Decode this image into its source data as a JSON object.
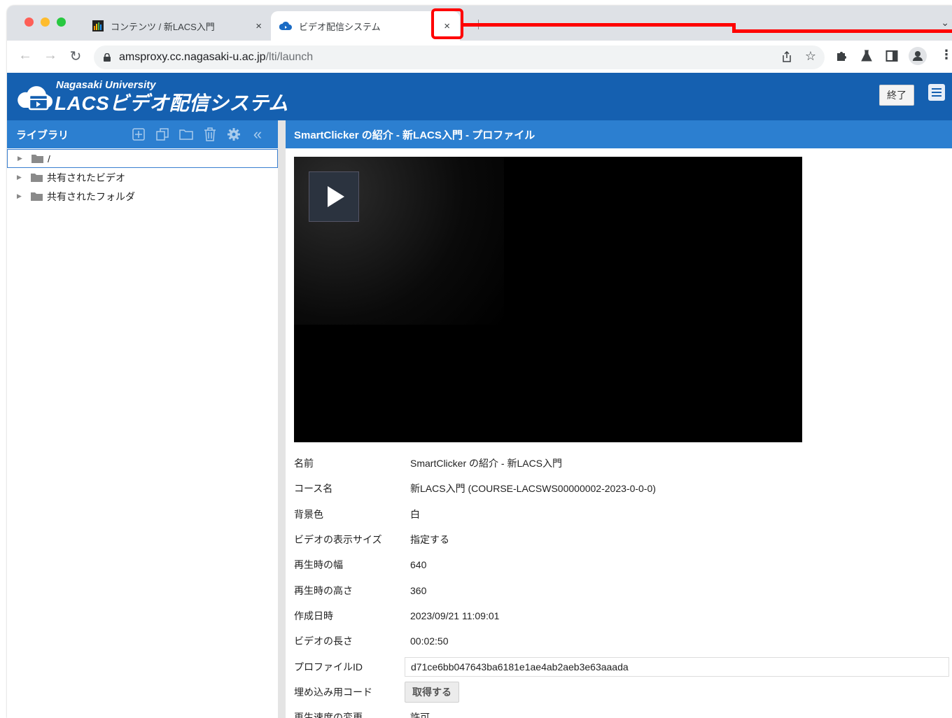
{
  "browser": {
    "tabs": [
      {
        "title": "コンテンツ / 新LACS入門",
        "close": "×"
      },
      {
        "title": "ビデオ配信システム",
        "close": "×"
      }
    ],
    "url_host": "amsproxy.cc.nagasaki-u.ac.jp",
    "url_path": "/lti/launch"
  },
  "header": {
    "university": "Nagasaki University",
    "system_name": "LACSビデオ配信システム",
    "exit_label": "終了"
  },
  "sidebar": {
    "title": "ライブラリ",
    "tree": [
      {
        "label": "/"
      },
      {
        "label": "共有されたビデオ"
      },
      {
        "label": "共有されたフォルダ"
      }
    ]
  },
  "main": {
    "title": "SmartClicker の紹介 - 新LACS入門 - プロファイル",
    "properties": [
      {
        "label": "名前",
        "value": "SmartClicker の紹介 - 新LACS入門"
      },
      {
        "label": "コース名",
        "value": "新LACS入門 (COURSE-LACSWS00000002-2023-0-0-0)"
      },
      {
        "label": "背景色",
        "value": "白"
      },
      {
        "label": "ビデオの表示サイズ",
        "value": "指定する"
      },
      {
        "label": "再生時の幅",
        "value": "640"
      },
      {
        "label": "再生時の高さ",
        "value": "360"
      },
      {
        "label": "作成日時",
        "value": "2023/09/21 11:09:01"
      },
      {
        "label": "ビデオの長さ",
        "value": "00:02:50"
      },
      {
        "label": "プロファイルID",
        "value": "d71ce6bb047643ba6181e1ae4ab2aeb3e63aaada"
      },
      {
        "label": "埋め込み用コード",
        "value": "取得する"
      },
      {
        "label": "再生速度の変更",
        "value": "許可"
      }
    ]
  },
  "colors": {
    "header_blue": "#1560b0",
    "panel_blue": "#2c7fd0",
    "annotation_red": "#ff0000"
  }
}
